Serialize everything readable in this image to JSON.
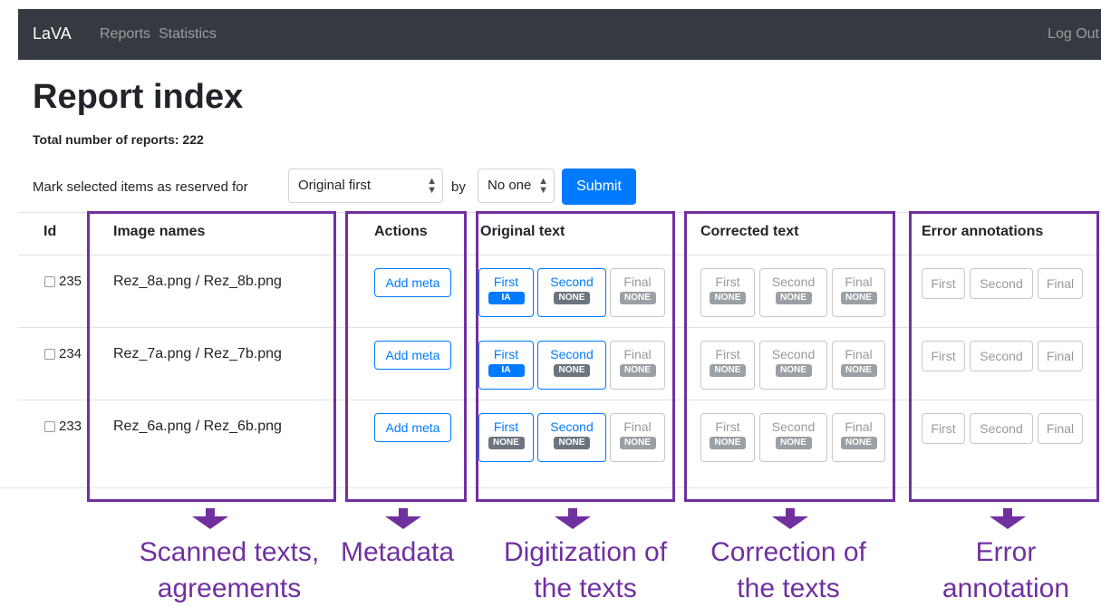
{
  "navbar": {
    "brand": "LaVA",
    "links": [
      "Reports",
      "Statistics"
    ],
    "logout": "Log Out"
  },
  "page": {
    "title": "Report index",
    "total": "Total number of reports: 222"
  },
  "form": {
    "mark_label": "Mark selected items as reserved for",
    "role_value": "Original first",
    "by_label": "by",
    "by_value": "No one",
    "submit": "Submit"
  },
  "table": {
    "headers": {
      "id": "Id",
      "image_names": "Image names",
      "actions": "Actions",
      "original": "Original text",
      "corrected": "Corrected text",
      "errors": "Error annotations"
    },
    "rows": [
      {
        "id": "235",
        "images": "Rez_8a.png / Rez_8b.png",
        "action": "Add meta",
        "original": [
          {
            "label": "First",
            "badge": "IA"
          },
          {
            "label": "Second",
            "badge": "NONE"
          },
          {
            "label": "Final",
            "badge": "NONE"
          }
        ],
        "corrected": [
          {
            "label": "First",
            "badge": "NONE"
          },
          {
            "label": "Second",
            "badge": "NONE"
          },
          {
            "label": "Final",
            "badge": "NONE"
          }
        ],
        "errors": [
          "First",
          "Second",
          "Final"
        ]
      },
      {
        "id": "234",
        "images": "Rez_7a.png / Rez_7b.png",
        "action": "Add meta",
        "original": [
          {
            "label": "First",
            "badge": "IA"
          },
          {
            "label": "Second",
            "badge": "NONE"
          },
          {
            "label": "Final",
            "badge": "NONE"
          }
        ],
        "corrected": [
          {
            "label": "First",
            "badge": "NONE"
          },
          {
            "label": "Second",
            "badge": "NONE"
          },
          {
            "label": "Final",
            "badge": "NONE"
          }
        ],
        "errors": [
          "First",
          "Second",
          "Final"
        ]
      },
      {
        "id": "233",
        "images": "Rez_6a.png / Rez_6b.png",
        "action": "Add meta",
        "original": [
          {
            "label": "First",
            "badge": "NONE"
          },
          {
            "label": "Second",
            "badge": "NONE"
          },
          {
            "label": "Final",
            "badge": "NONE"
          }
        ],
        "corrected": [
          {
            "label": "First",
            "badge": "NONE"
          },
          {
            "label": "Second",
            "badge": "NONE"
          },
          {
            "label": "Final",
            "badge": "NONE"
          }
        ],
        "errors": [
          "First",
          "Second",
          "Final"
        ]
      }
    ]
  },
  "annotations": {
    "captions": [
      "Scanned texts, agreements",
      "Metadata",
      "Digitization of the texts",
      "Correction of the texts",
      "Error annotation"
    ],
    "color": "#7030a0"
  }
}
